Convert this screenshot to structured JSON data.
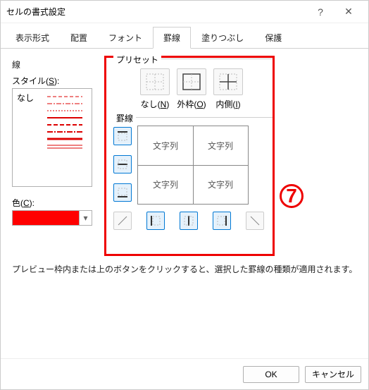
{
  "window": {
    "title": "セルの書式設定",
    "help": "?",
    "close": "✕"
  },
  "tabs": [
    "表示形式",
    "配置",
    "フォント",
    "罫線",
    "塗りつぶし",
    "保護"
  ],
  "active_tab_index": 3,
  "left": {
    "group": "線",
    "style_label_pre": "スタイル(",
    "style_key": "S",
    "style_label_post": "):",
    "style_none": "なし",
    "color_label_pre": "色(",
    "color_key": "C",
    "color_label_post": "):",
    "color_value": "#ff0000"
  },
  "presets": {
    "group": "プリセット",
    "items": [
      {
        "name": "none",
        "label_pre": "なし(",
        "key": "N",
        "label_post": ")"
      },
      {
        "name": "outline",
        "label_pre": "外枠(",
        "key": "O",
        "label_post": ")"
      },
      {
        "name": "inside",
        "label_pre": "内側(",
        "key": "I",
        "label_post": ")"
      }
    ]
  },
  "border": {
    "group": "罫線",
    "preview_cells": [
      "文字列",
      "文字列",
      "文字列",
      "文字列"
    ]
  },
  "annotation": "⑦",
  "help_text": "プレビュー枠内または上のボタンをクリックすると、選択した罫線の種類が適用されます。",
  "footer": {
    "ok": "OK",
    "cancel": "キャンセル"
  }
}
